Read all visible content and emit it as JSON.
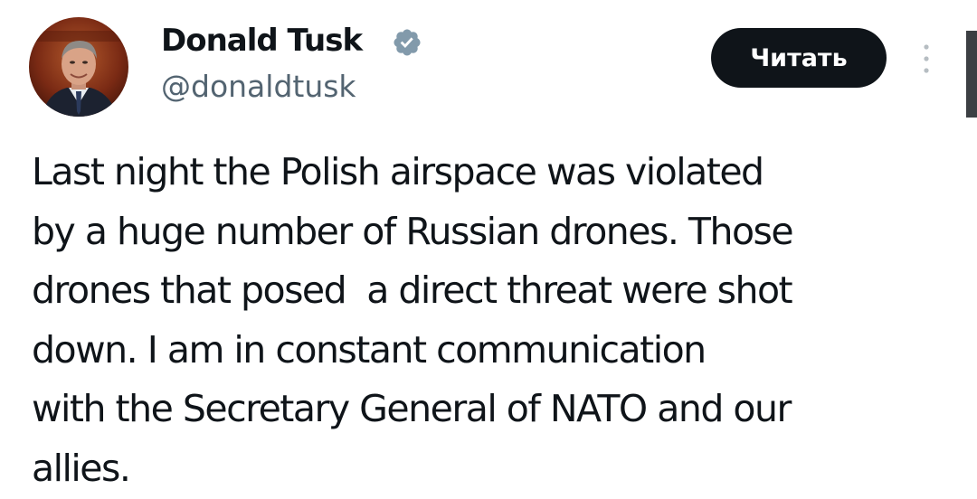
{
  "author": {
    "display_name": "Donald Tusk",
    "handle": "@donaldtusk",
    "avatar_icon": "profile-photo",
    "verified_icon": "verified-badge-icon",
    "verified_color": "#829aab"
  },
  "actions": {
    "follow_label": "Читать",
    "more_icon": "more-vertical-icon"
  },
  "tweet": {
    "lines": [
      "Last night the Polish airspace was violated",
      "by a huge number of Russian drones. Those",
      "drones that posed  a direct threat were shot",
      "down. I am in constant communication",
      "with the Secretary General of NATO and our",
      "allies."
    ]
  },
  "colors": {
    "text": "#0f1419",
    "secondary_text": "#536471",
    "button_bg": "#0f1419",
    "button_text": "#ffffff",
    "background": "#ffffff"
  }
}
